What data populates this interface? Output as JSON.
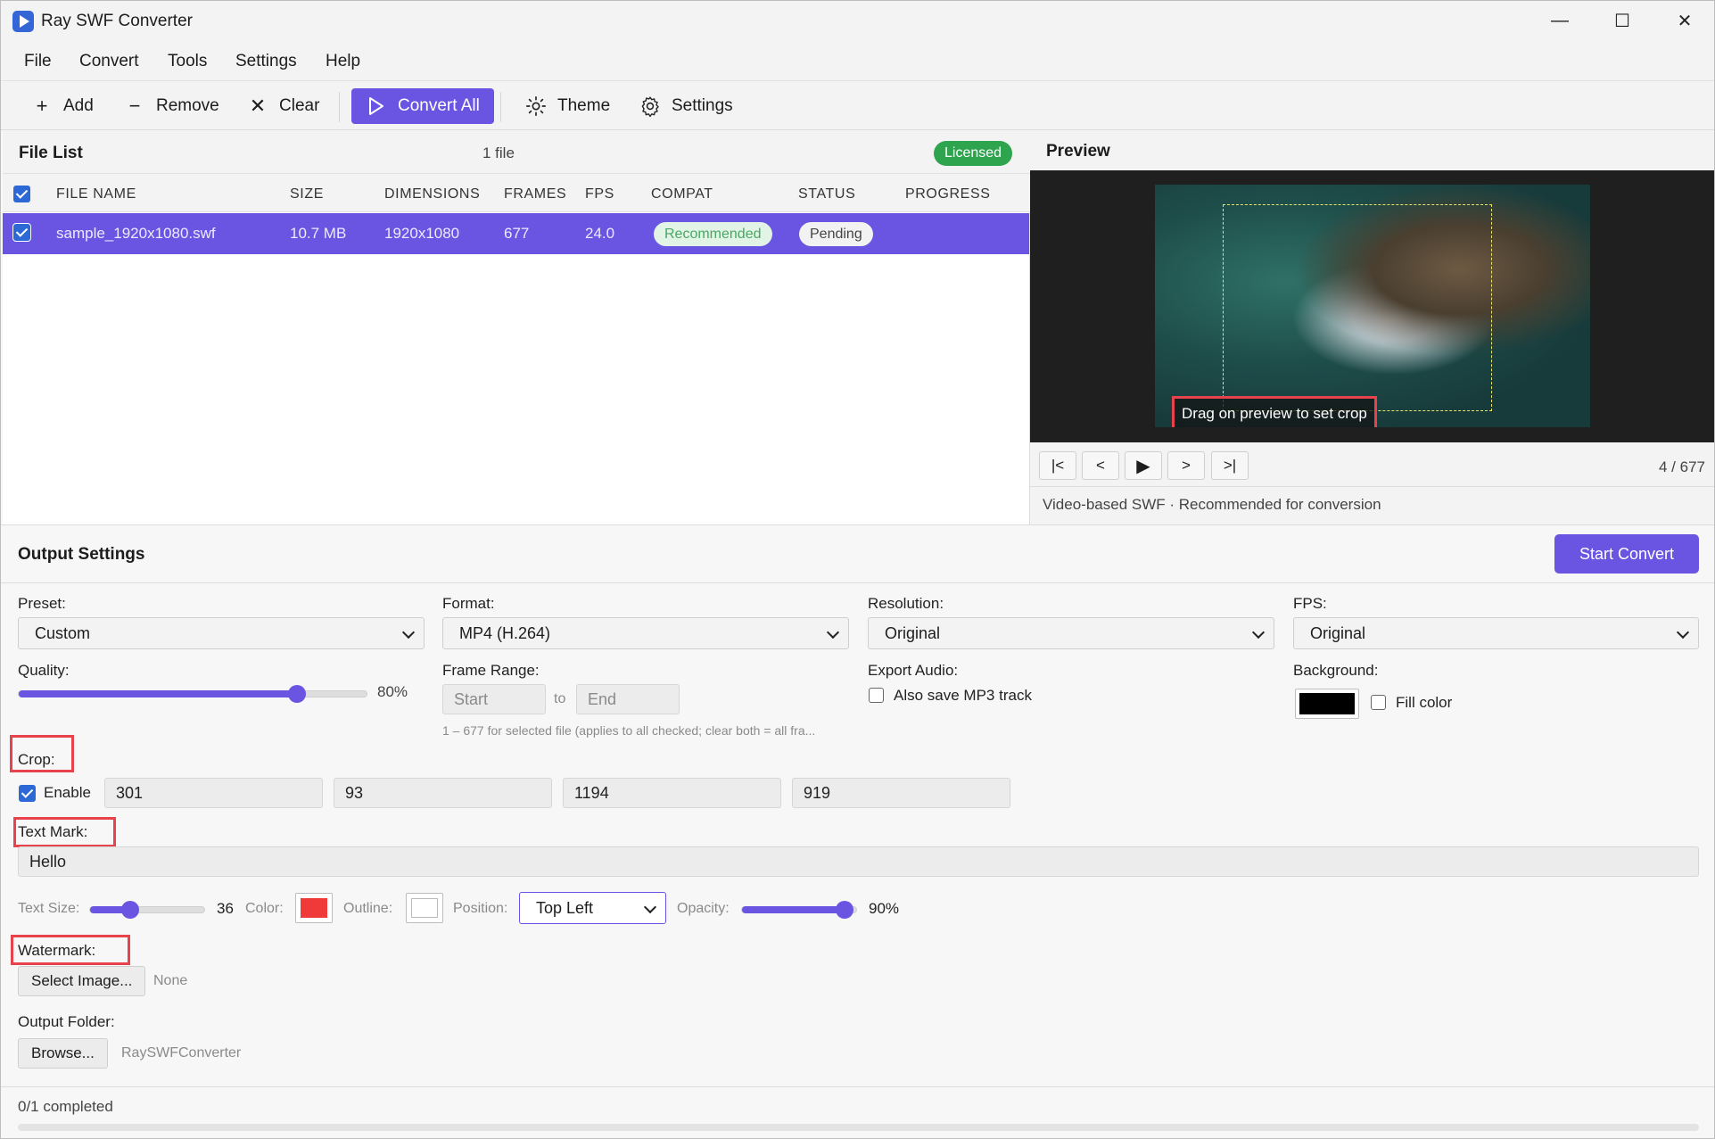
{
  "window": {
    "title": "Ray SWF Converter",
    "minimize": "—",
    "maximize": "☐",
    "close": "✕"
  },
  "menu": [
    "File",
    "Convert",
    "Tools",
    "Settings",
    "Help"
  ],
  "toolbar": {
    "add": "Add",
    "remove": "Remove",
    "clear": "Clear",
    "convert_all": "Convert All",
    "theme": "Theme",
    "settings": "Settings"
  },
  "file_list": {
    "title": "File List",
    "count": "1 file",
    "license_badge": "Licensed",
    "columns": [
      "FILE NAME",
      "SIZE",
      "DIMENSIONS",
      "FRAMES",
      "FPS",
      "COMPAT",
      "STATUS",
      "PROGRESS"
    ],
    "rows": [
      {
        "checked": true,
        "file_name": "sample_1920x1080.swf",
        "size": "10.7 MB",
        "dimensions": "1920x1080",
        "frames": "677",
        "fps": "24.0",
        "compat": "Recommended",
        "status": "Pending",
        "progress": ""
      }
    ]
  },
  "preview": {
    "title": "Preview",
    "hint": "Drag on preview to set crop",
    "buttons": [
      "|<",
      "<",
      "▶",
      ">",
      ">|"
    ],
    "frame_counter": "4 / 677",
    "info": "Video-based SWF · Recommended for conversion"
  },
  "output": {
    "title": "Output Settings",
    "start_button": "Start Convert",
    "preset": {
      "label": "Preset:",
      "value": "Custom"
    },
    "format": {
      "label": "Format:",
      "value": "MP4 (H.264)"
    },
    "resolution": {
      "label": "Resolution:",
      "value": "Original"
    },
    "fps": {
      "label": "FPS:",
      "value": "Original"
    },
    "quality": {
      "label": "Quality:",
      "value": "80%",
      "level": 0.8
    },
    "frame_range": {
      "label": "Frame Range:",
      "start_placeholder": "Start",
      "to": "to",
      "end_placeholder": "End",
      "hint": "1 – 677 for selected file (applies to all checked; clear both = all fra..."
    },
    "export_audio": {
      "label": "Export Audio:",
      "checkbox_label": "Also save MP3 track",
      "checked": false
    },
    "background": {
      "label": "Background:",
      "color": "#000000",
      "checkbox_label": "Fill color",
      "checked": false
    },
    "crop": {
      "label": "Crop:",
      "enable_label": "Enable",
      "enabled": true,
      "values": [
        "301",
        "93",
        "1194",
        "919"
      ]
    },
    "text_mark": {
      "label": "Text Mark:",
      "value": "Hello",
      "size_label": "Text Size:",
      "size_value": "36",
      "size_level": 0.35,
      "color_label": "Color:",
      "color": "#f03a3a",
      "outline_label": "Outline:",
      "outline_color": "#ffffff",
      "position_label": "Position:",
      "position_value": "Top Left",
      "opacity_label": "Opacity:",
      "opacity_value": "90%",
      "opacity_level": 0.9
    },
    "watermark": {
      "label": "Watermark:",
      "button": "Select Image...",
      "value": "None"
    },
    "output_folder": {
      "label": "Output Folder:",
      "button": "Browse...",
      "value": "RaySWFConverter"
    }
  },
  "status": {
    "completed": "0/1 completed",
    "progress": 0
  },
  "colors": {
    "accent": "#6a54e2",
    "licensed": "#2ea44f",
    "highlight": "#e8424c"
  }
}
